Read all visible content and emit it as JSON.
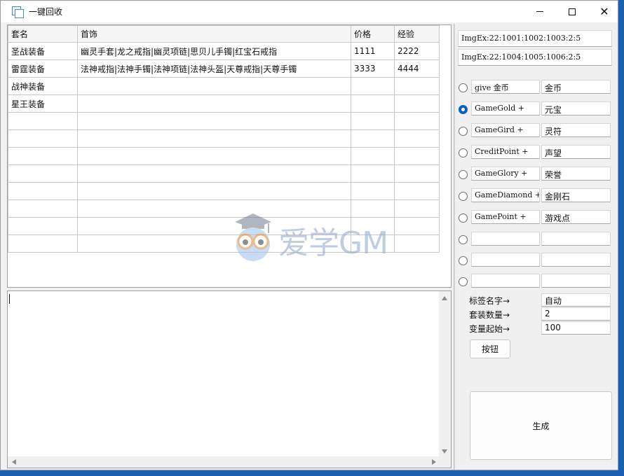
{
  "window": {
    "title": "一键回收"
  },
  "grid": {
    "columns": [
      "套名",
      "首饰",
      "价格",
      "经验"
    ],
    "rows": [
      [
        "圣战装备",
        "幽灵手套|龙之戒指|幽灵项链|思贝儿手镯|红宝石戒指",
        "1111",
        "2222"
      ],
      [
        "雷霆装备",
        "法神戒指|法神手镯|法神项链|法神头盔|天尊戒指|天尊手镯",
        "3333",
        "4444"
      ],
      [
        "战神装备",
        "",
        "",
        ""
      ],
      [
        "星王装备",
        "",
        "",
        ""
      ],
      [
        "",
        "",
        "",
        ""
      ],
      [
        "",
        "",
        "",
        ""
      ],
      [
        "",
        "",
        "",
        ""
      ],
      [
        "",
        "",
        "",
        ""
      ],
      [
        "",
        "",
        "",
        ""
      ],
      [
        "",
        "",
        "",
        ""
      ],
      [
        "",
        "",
        "",
        ""
      ],
      [
        "",
        "",
        "",
        ""
      ]
    ]
  },
  "img_fields": [
    "ImgEx:22:1001:1002:1003:2:5",
    "ImgEx:22:1004:1005:1006:2:5"
  ],
  "currency_options": [
    {
      "command": "give 金币",
      "name": "金币",
      "checked": false
    },
    {
      "command": "GameGold +",
      "name": "元宝",
      "checked": true
    },
    {
      "command": "GameGird +",
      "name": "灵符",
      "checked": false
    },
    {
      "command": "CreditPoint +",
      "name": "声望",
      "checked": false
    },
    {
      "command": "GameGlory +",
      "name": "荣誉",
      "checked": false
    },
    {
      "command": "GameDiamond +",
      "name": "金刚石",
      "checked": false
    },
    {
      "command": "GamePoint +",
      "name": "游戏点",
      "checked": false
    },
    {
      "command": "",
      "name": "",
      "checked": false
    },
    {
      "command": "",
      "name": "",
      "checked": false
    },
    {
      "command": "",
      "name": "",
      "checked": false
    }
  ],
  "settings": [
    {
      "label": "标签名字→",
      "value": "自动"
    },
    {
      "label": "套装数量→",
      "value": "2"
    },
    {
      "label": "变量起始→",
      "value": "100"
    }
  ],
  "buttons": {
    "small": "按钮",
    "generate": "生成"
  },
  "watermark": {
    "text": "爱学GM"
  },
  "colors": {
    "accent": "#0a5fc7",
    "desktop": "#1a5fb4"
  }
}
